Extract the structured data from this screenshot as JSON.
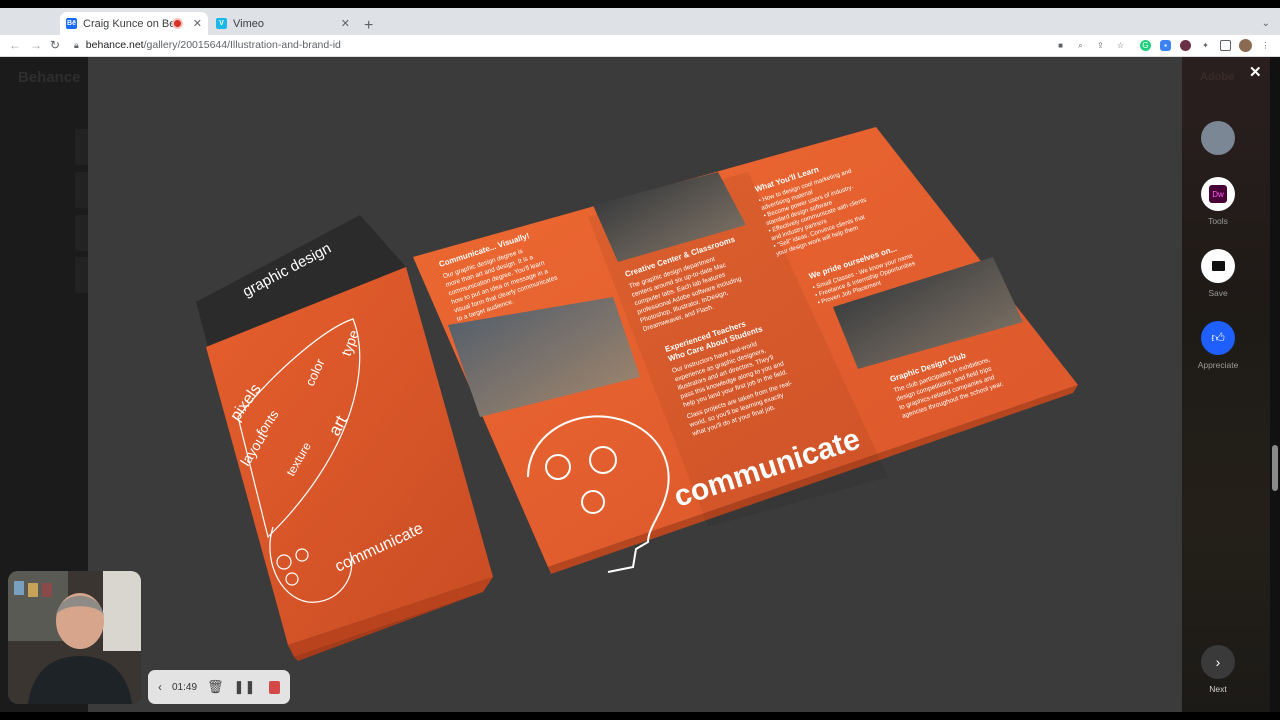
{
  "browser": {
    "tabs": [
      {
        "title": "Craig Kunce on Behance",
        "favicon": "Bē",
        "recording": true,
        "active": true
      },
      {
        "title": "Vimeo",
        "favicon": "V",
        "recording": false,
        "active": false
      }
    ],
    "new_tab": "+",
    "url_host": "behance.net",
    "url_path": "/gallery/20015644/Illustration-and-brand-id"
  },
  "page": {
    "logo": "Behance",
    "adobe": "Adobe"
  },
  "brochure": {
    "cover_title": "graphic design",
    "cover_word": "communicate",
    "panel1_heading": "Communicate... Visually!",
    "panel1_body": [
      "Our graphic design degree is",
      "more than art and design. It is a",
      "communication degree. You'll learn",
      "how to put an idea or message in a",
      "visual form that clearly communicates",
      "to a target audience."
    ],
    "panel2_heading": "Creative Center & Classrooms",
    "panel2_body": [
      "The graphic design department",
      "centers around six up-to-date Mac",
      "computer labs. Each lab features",
      "professional Adobe software including",
      "Photoshop, Illustrator, InDesign,",
      "Dreamweaver, and Flash."
    ],
    "panel3_heading": "Experienced Teachers",
    "panel3_heading2": "Who Care About Students",
    "panel3_body": [
      "Our instructors have real-world",
      "experience as graphic designers,",
      "illustrators and art directors. They'll",
      "pass this knowledge along to you and",
      "help you land your first job in the field.",
      "Class projects are taken from the real-",
      "world, so you'll be learning exactly",
      "what you'll do at your final job."
    ],
    "panel4_heading": "What You'll Learn",
    "panel4_body": [
      "• How to design cool marketing and",
      "  advertising material",
      "• Become power users of industry-",
      "  standard design software",
      "• Effectively communicate with clients",
      "  and industry partners",
      "• \"Sell\" ideas. Convince clients that",
      "  your design work will help them"
    ],
    "panel5_heading": "We pride ourselves on...",
    "panel5_body": [
      "• Small Classes - We know your name",
      "• Freelance & Internship Opportunities",
      "• Proven Job Placement"
    ],
    "panel6_heading": "Graphic Design Club",
    "panel6_body": [
      "The club participates in exhibitions,",
      "design competitions, and field trips",
      "to graphics-related companies and",
      "agencies throughout the school year."
    ],
    "big_word": "communicate",
    "cover_words": [
      "pixels",
      "fonts",
      "layout",
      "color",
      "texture",
      "art",
      "type"
    ]
  },
  "sidebar": {
    "tools_label": "Tools",
    "tools_badge": "Dw",
    "save_label": "Save",
    "appreciate_label": "Appreciate",
    "next_label": "Next"
  },
  "recorder": {
    "time": "01:49"
  },
  "colors": {
    "brochure_orange": "#e8602c",
    "appreciate_blue": "#1f5eff",
    "dw_purple": "#470137"
  }
}
